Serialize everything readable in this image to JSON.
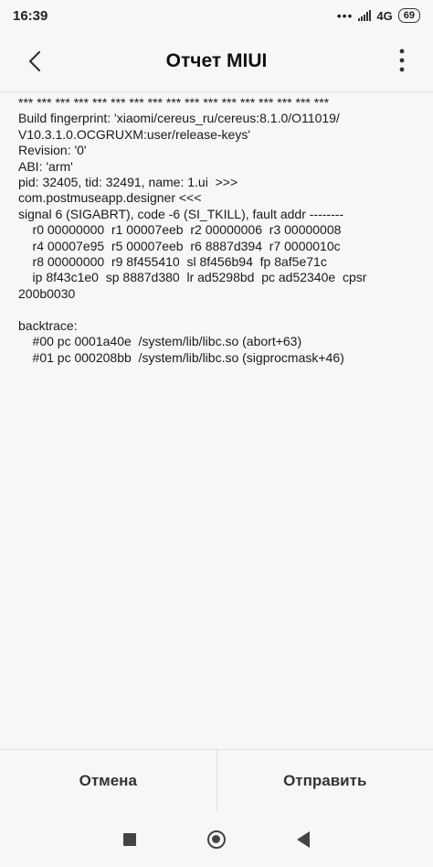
{
  "status_bar": {
    "time": "16:39",
    "network": "4G",
    "battery": "69",
    "icons": [
      "dots-icon",
      "signal-icon",
      "battery-icon"
    ]
  },
  "header": {
    "title": "Отчет MIUI",
    "back_icon": "chevron-left-icon",
    "menu_icon": "more-vertical-icon"
  },
  "log": {
    "lines": [
      "*** *** *** *** *** *** *** *** *** *** *** *** *** *** *** *** ***",
      "Build fingerprint: 'xiaomi/cereus_ru/cereus:8.1.0/O11019/",
      "V10.3.1.0.OCGRUXM:user/release-keys'",
      "Revision: '0'",
      "ABI: 'arm'",
      "pid: 32405, tid: 32491, name: 1.ui  >>>",
      "com.postmuseapp.designer <<<",
      "signal 6 (SIGABRT), code -6 (SI_TKILL), fault addr --------",
      "    r0 00000000  r1 00007eeb  r2 00000006  r3 00000008",
      "    r4 00007e95  r5 00007eeb  r6 8887d394  r7 0000010c",
      "    r8 00000000  r9 8f455410  sl 8f456b94  fp 8af5e71c",
      "    ip 8f43c1e0  sp 8887d380  lr ad5298bd  pc ad52340e  cpsr",
      "200b0030",
      "",
      "backtrace:",
      "    #00 pc 0001a40e  /system/lib/libc.so (abort+63)",
      "    #01 pc 000208bb  /system/lib/libc.so (sigprocmask+46)"
    ]
  },
  "actions": {
    "cancel_label": "Отмена",
    "send_label": "Отправить"
  },
  "nav": {
    "icons": [
      "recents-square-icon",
      "home-circle-icon",
      "back-triangle-icon"
    ]
  },
  "colors": {
    "background": "#f7f7f7",
    "text": "#111111",
    "divider": "#e0e0e0"
  }
}
